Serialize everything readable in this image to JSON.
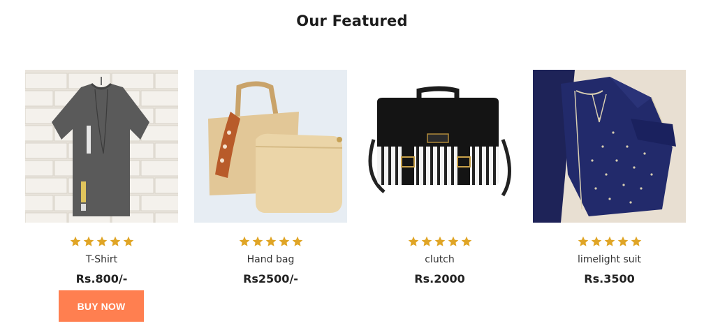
{
  "section": {
    "title": "Our Featured"
  },
  "rating_color": "#e0a526",
  "button_color": "#ff7f50",
  "products": [
    {
      "name": "T-Shirt",
      "price": "Rs.800/-",
      "rating": 5,
      "image": "gray-tshirt-photo"
    },
    {
      "name": "Hand bag",
      "price": "Rs2500/-",
      "rating": 5,
      "image": "beige-handbag-photo"
    },
    {
      "name": "clutch",
      "price": "Rs.2000",
      "rating": 5,
      "image": "black-striped-clutch-photo"
    },
    {
      "name": "limelight suit",
      "price": "Rs.3500",
      "rating": 5,
      "image": "navy-embroidered-suit-photo"
    }
  ],
  "buy_button": {
    "label": "BUY NOW"
  }
}
